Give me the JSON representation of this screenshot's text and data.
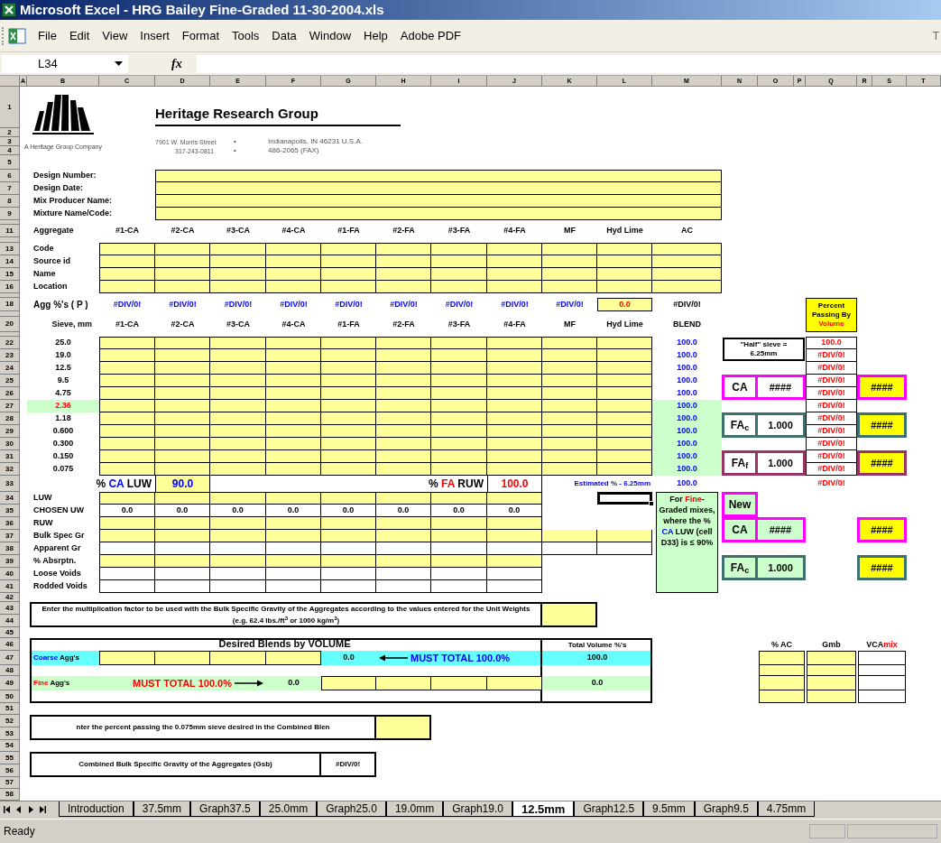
{
  "window": {
    "title": "Microsoft Excel - HRG Bailey Fine-Graded 11-30-2004.xls"
  },
  "menu": [
    "File",
    "Edit",
    "View",
    "Insert",
    "Format",
    "Tools",
    "Data",
    "Window",
    "Help",
    "Adobe PDF"
  ],
  "question_box": "T",
  "formula_bar": {
    "name_box": "L34",
    "function_label": "fx"
  },
  "columns": [
    "A",
    "B",
    "C",
    "D",
    "E",
    "F",
    "G",
    "H",
    "I",
    "J",
    "K",
    "L",
    "M",
    "N",
    "O",
    "P",
    "Q",
    "R",
    "S",
    "T"
  ],
  "row_numbers": [
    "1",
    "2",
    "3",
    "4",
    "5",
    "6",
    "7",
    "8",
    "9",
    "11",
    "13",
    "14",
    "15",
    "16",
    "18",
    "20",
    "22",
    "23",
    "24",
    "25",
    "26",
    "27",
    "28",
    "29",
    "30",
    "31",
    "32",
    "33",
    "34",
    "35",
    "36",
    "37",
    "38",
    "39",
    "40",
    "41",
    "42",
    "43",
    "44",
    "45",
    "46",
    "47",
    "48",
    "49",
    "50",
    "51",
    "52",
    "53",
    "54",
    "55",
    "56",
    "57",
    "58"
  ],
  "letterhead": {
    "company": "Heritage Research Group",
    "tagline": "A Heritage Group Company",
    "address": [
      [
        "7901 W. Morris Street",
        "•",
        "Indianapolis, IN 46231 U.S.A."
      ],
      [
        "317-243-0811",
        "•",
        "486-2065 (FAX)"
      ]
    ]
  },
  "design_fields": [
    "Design Number:",
    "Design Date:",
    "Mix Producer Name:",
    "Mixture Name/Code:"
  ],
  "aggregates": {
    "label": "Aggregate",
    "headers": [
      "#1-CA",
      "#2-CA",
      "#3-CA",
      "#4-CA",
      "#1-FA",
      "#2-FA",
      "#3-FA",
      "#4-FA",
      "MF",
      "Hyd Lime",
      "AC"
    ],
    "rows": [
      "Code",
      "Source id",
      "Name",
      "Location"
    ]
  },
  "agg_percent": {
    "label": "Agg %'s ( P )",
    "values": [
      "#DIV/0!",
      "#DIV/0!",
      "#DIV/0!",
      "#DIV/0!",
      "#DIV/0!",
      "#DIV/0!",
      "#DIV/0!",
      "#DIV/0!",
      "#DIV/0!"
    ],
    "hyd_lime": "0.0",
    "ac": "#DIV/0!"
  },
  "sieve_table": {
    "label": "Sieve, mm",
    "headers": [
      "#1-CA",
      "#2-CA",
      "#3-CA",
      "#4-CA",
      "#1-FA",
      "#2-FA",
      "#3-FA",
      "#4-FA",
      "MF",
      "Hyd Lime"
    ],
    "blend_header": "BLEND",
    "rows": [
      {
        "size": "25.0",
        "blend": "100.0",
        "passing": "100.0",
        "highlighted": false,
        "blend_shaded": false
      },
      {
        "size": "19.0",
        "blend": "100.0",
        "passing": "#DIV/0!",
        "highlighted": false,
        "blend_shaded": false
      },
      {
        "size": "12.5",
        "blend": "100.0",
        "passing": "#DIV/0!",
        "highlighted": false,
        "blend_shaded": false
      },
      {
        "size": "9.5",
        "blend": "100.0",
        "passing": "#DIV/0!",
        "highlighted": false,
        "blend_shaded": false
      },
      {
        "size": "4.75",
        "blend": "100.0",
        "passing": "#DIV/0!",
        "highlighted": false,
        "blend_shaded": false
      },
      {
        "size": "2.36",
        "blend": "100.0",
        "passing": "#DIV/0!",
        "highlighted": true,
        "blend_shaded": true
      },
      {
        "size": "1.18",
        "blend": "100.0",
        "passing": "#DIV/0!",
        "highlighted": false,
        "blend_shaded": true
      },
      {
        "size": "0.600",
        "blend": "100.0",
        "passing": "#DIV/0!",
        "highlighted": false,
        "blend_shaded": true
      },
      {
        "size": "0.300",
        "blend": "100.0",
        "passing": "#DIV/0!",
        "highlighted": false,
        "blend_shaded": true
      },
      {
        "size": "0.150",
        "blend": "100.0",
        "passing": "#DIV/0!",
        "highlighted": false,
        "blend_shaded": true
      },
      {
        "size": "0.075",
        "blend": "100.0",
        "passing": "#DIV/0!",
        "highlighted": false,
        "blend_shaded": true
      }
    ]
  },
  "percent_passing_header": {
    "text": "Percent Passing By",
    "accent": "Volume"
  },
  "half_sieve": [
    "\"Half\" sieve =",
    "6.25mm"
  ],
  "factor_boxes": [
    {
      "label": "CA",
      "value": "####",
      "color": "#ff00ff",
      "result": "####"
    },
    {
      "label": "FA$_{c}$",
      "value": "1.000",
      "color": "#3f7070",
      "result": "####"
    },
    {
      "label": "FA$_{f}$",
      "value": "1.000",
      "color": "#993366",
      "result": "####"
    }
  ],
  "luw_row": {
    "ca_label": {
      "prefix": "%",
      "accent": "CA",
      "suffix": "LUW"
    },
    "ca_value": "90.0",
    "fa_label": {
      "prefix": "%",
      "accent": "FA",
      "suffix": "RUW"
    },
    "fa_value": "100.0",
    "estimate_label": "Estimated % - 6.25mm",
    "blend": "100.0",
    "passing": "#DIV/0!"
  },
  "properties": [
    {
      "label": "LUW",
      "kind": "input"
    },
    {
      "label": "CHOSEN UW",
      "kind": "values",
      "values": [
        "0.0",
        "0.0",
        "0.0",
        "0.0",
        "0.0",
        "0.0",
        "0.0",
        "0.0"
      ]
    },
    {
      "label": "RUW",
      "kind": "input"
    },
    {
      "label": "Bulk Spec Gr",
      "kind": "input-wide"
    },
    {
      "label": "Apparent Gr",
      "kind": "blank-wide"
    },
    {
      "label": "% Absrptn.",
      "kind": "input"
    },
    {
      "label": "Loose Voids",
      "kind": "blank"
    },
    {
      "label": "Rodded Voids",
      "kind": "blank"
    }
  ],
  "fine_graded_note": [
    {
      "text": "For "
    },
    {
      "text": "Fine",
      "color": "#ff0000"
    },
    {
      "text": "-Graded mixes, where the % "
    },
    {
      "text": "CA",
      "color": "#0000ff"
    },
    {
      "text": " LUW (cell D33) is ≤ 90%"
    }
  ],
  "new_section": {
    "label": "New",
    "boxes": [
      {
        "label": "CA",
        "value": "####",
        "color": "#ff00ff",
        "result": "####"
      },
      {
        "label": "FA$_{c}$",
        "value": "1.000",
        "color": "#3f7070",
        "result": "####"
      }
    ]
  },
  "multiplication_note": "Enter the multiplication factor to be used with the Bulk Specific Gravity of the Aggregates according to the values entered for the Unit Weights (e.g. 62.4 lbs./ft$^{3}$ or 1000 kg/m$^{3}$)",
  "blends": {
    "title": "Desired Blends by VOLUME",
    "total_title": "Total Volume %'s",
    "coarse": {
      "accent": "Coarse",
      "label": "Agg's",
      "sum": "0.0",
      "must_total": "MUST TOTAL 100.0%",
      "total": "100.0"
    },
    "fine": {
      "accent": "Fine",
      "label": "Agg's",
      "sum": "0.0",
      "must_total": "MUST TOTAL 100.0%",
      "total": "0.0"
    }
  },
  "passing_note": "nter the percent passing the 0.075mm sieve desired in the Combined Blen",
  "gsb": {
    "label": "Combined Bulk Specific Gravity of the Aggregates (Gsb)",
    "value": "#DIV/0!"
  },
  "vca_table": {
    "headers": [
      {
        "text": "% AC",
        "kind": "input"
      },
      {
        "text": "Gmb",
        "kind": "input"
      },
      {
        "text": "VCA",
        "accent": "mix",
        "kind": "blank"
      }
    ]
  },
  "sheet_tabs": [
    {
      "label": "Introduction",
      "selected": false
    },
    {
      "label": "37.5mm",
      "selected": false
    },
    {
      "label": "Graph37.5",
      "selected": false
    },
    {
      "label": "25.0mm",
      "selected": false
    },
    {
      "label": "Graph25.0",
      "selected": false
    },
    {
      "label": "19.0mm",
      "selected": false
    },
    {
      "label": "Graph19.0",
      "selected": false
    },
    {
      "label": "12.5mm",
      "selected": true
    },
    {
      "label": "Graph12.5",
      "selected": false
    },
    {
      "label": "9.5mm",
      "selected": false
    },
    {
      "label": "Graph9.5",
      "selected": false
    },
    {
      "label": "4.75mm",
      "selected": false
    }
  ],
  "status": "Ready"
}
